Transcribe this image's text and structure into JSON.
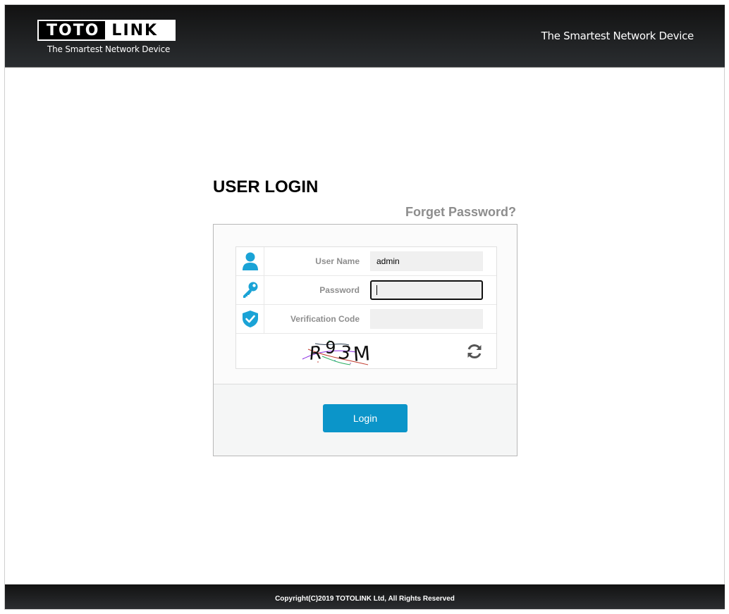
{
  "header": {
    "logo_left": "TOTO",
    "logo_right": "LINK",
    "logo_tagline": "The Smartest Network Device",
    "tagline": "The Smartest Network Device"
  },
  "login": {
    "title": "USER LOGIN",
    "forget_password": "Forget Password?",
    "fields": {
      "username": {
        "label": "User Name",
        "value": "admin",
        "icon": "user-icon"
      },
      "password": {
        "label": "Password",
        "value": "",
        "icon": "key-icon"
      },
      "verification": {
        "label": "Verification Code",
        "value": "",
        "icon": "shield-check-icon"
      }
    },
    "captcha": {
      "chars": [
        "R",
        "9",
        "3",
        "M"
      ],
      "icon": "refresh-icon"
    },
    "login_button": "Login"
  },
  "footer": {
    "copyright": "Copyright(C)2019 TOTOLINK Ltd, All Rights Reserved"
  },
  "colors": {
    "accent": "#0b95c9",
    "icon_blue": "#1aa3d6",
    "header_bg": "#1a1a1a"
  }
}
